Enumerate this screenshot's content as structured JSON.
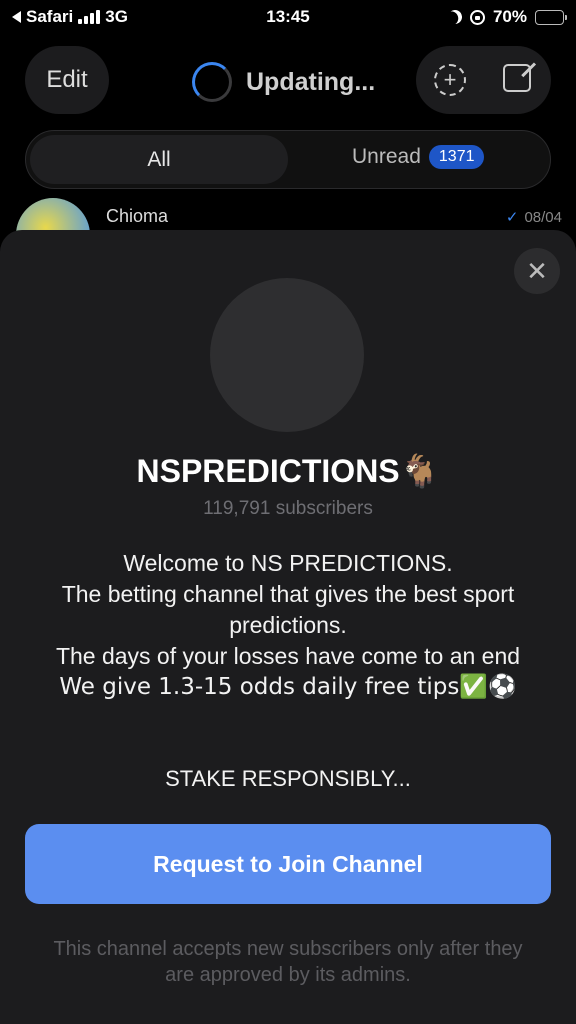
{
  "status_bar": {
    "back_app": "Safari",
    "network": "3G",
    "time": "13:45",
    "battery_percent": "70%",
    "battery_level": 0.62,
    "battery_color": "#f7c91c"
  },
  "header": {
    "edit_label": "Edit",
    "title": "Updating...",
    "story_icon": "add-story-icon",
    "compose_icon": "compose-icon"
  },
  "filters": {
    "all_label": "All",
    "unread_label": "Unread",
    "unread_count": "1371"
  },
  "background_chat": {
    "name": "Chioma",
    "date": "08/04"
  },
  "channel": {
    "name": "NSPREDICTIONS",
    "name_emoji": "🐐",
    "subscribers": "119,791 subscribers",
    "description_lines": [
      "Welcome to NS PREDICTIONS.",
      "The betting channel that gives the best sport predictions.",
      "The days of your losses have come to an end",
      "We give 1.3-15 odds daily free tips✅⚽"
    ],
    "stake_text": "STAKE RESPONSIBLY...",
    "join_label": "Request to Join Channel",
    "note": "This channel accepts new subscribers only after they are approved by its admins."
  },
  "colors": {
    "accent": "#5b8ef0",
    "badge": "#1e56c7",
    "sheet_bg": "#1c1c1e"
  }
}
